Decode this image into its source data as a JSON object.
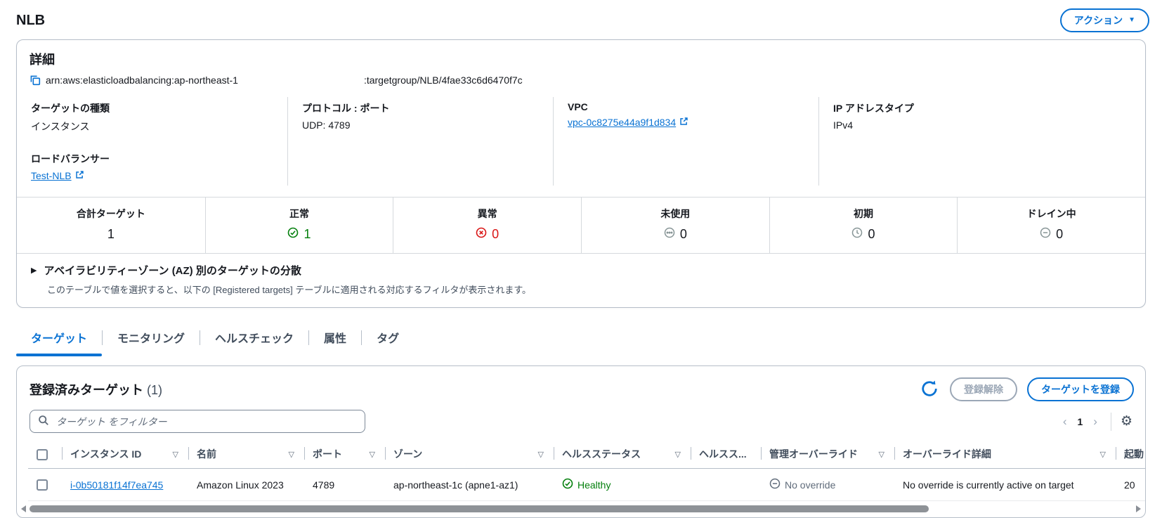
{
  "colors": {
    "accent": "#0972d3",
    "healthy_green": "#037f0c",
    "error_red": "#d91515",
    "muted_gray": "#5f6b7a"
  },
  "header": {
    "title": "NLB",
    "actions_label": "アクション",
    "actions_caret": "▼"
  },
  "details": {
    "heading": "詳細",
    "arn_prefix": "arn:aws:elasticloadbalancing:ap-northeast-1",
    "arn_suffix": ":targetgroup/NLB/4fae33c6d6470f7c",
    "target_type": {
      "label": "ターゲットの種類",
      "value": "インスタンス"
    },
    "load_balancer": {
      "label": "ロードバランサー",
      "value": "Test-NLB"
    },
    "protocol_port": {
      "label": "プロトコル : ポート",
      "value": "UDP: 4789"
    },
    "vpc": {
      "label": "VPC",
      "value": "vpc-0c8275e44a9f1d834"
    },
    "ip_type": {
      "label": "IP アドレスタイプ",
      "value": "IPv4"
    }
  },
  "stats": [
    {
      "label": "合計ターゲット",
      "value": "1"
    },
    {
      "label": "正常",
      "value": "1"
    },
    {
      "label": "異常",
      "value": "0"
    },
    {
      "label": "未使用",
      "value": "0"
    },
    {
      "label": "初期",
      "value": "0"
    },
    {
      "label": "ドレイン中",
      "value": "0"
    }
  ],
  "az_panel": {
    "expander_icon": "▶",
    "title": "アベイラビリティーゾーン (AZ) 別のターゲットの分散",
    "description": "このテーブルで値を選択すると、以下の [Registered targets] テーブルに適用される対応するフィルタが表示されます。"
  },
  "tabs": [
    {
      "label": "ターゲット"
    },
    {
      "label": "モニタリング"
    },
    {
      "label": "ヘルスチェック"
    },
    {
      "label": "属性"
    },
    {
      "label": "タグ"
    }
  ],
  "registered": {
    "title": "登録済みターゲット",
    "count": "(1)",
    "deregister_label": "登録解除",
    "register_label": "ターゲットを登録",
    "filter_placeholder": "ターゲット をフィルター",
    "filter_glyph": "▽",
    "pagination": {
      "prev": "‹",
      "page": "1",
      "next": "›"
    },
    "gear_glyph": "⚙"
  },
  "table": {
    "columns": [
      "インスタンス ID",
      "名前",
      "ポート",
      "ゾーン",
      "ヘルスステータス",
      "ヘルスス...",
      "管理オーバーライド",
      "オーバーライド詳細",
      "起動"
    ],
    "row": {
      "instance_id": "i-0b50181f14f7ea745",
      "name": "Amazon Linux 2023",
      "port": "4789",
      "zone": "ap-northeast-1c (apne1-az1)",
      "health_status": "Healthy",
      "admin_override": "No override",
      "override_detail": "No override is currently active on target",
      "launch_time": "20"
    }
  }
}
